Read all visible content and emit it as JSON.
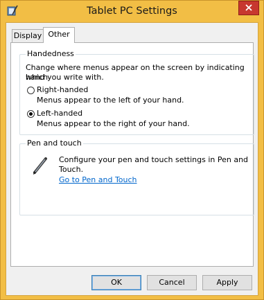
{
  "window": {
    "title": "Tablet PC Settings",
    "icon": "tablet-pc-settings-icon",
    "close_icon": "close-icon"
  },
  "tabs": [
    {
      "label": "Display",
      "selected": false
    },
    {
      "label": "Other",
      "selected": true
    }
  ],
  "handedness": {
    "legend": "Handedness",
    "description_line1": "Change where menus appear on the screen by indicating which",
    "description_line2": "hand you write with.",
    "options": [
      {
        "label": "Right-handed",
        "hint": "Menus appear to the left of your hand.",
        "checked": false
      },
      {
        "label": "Left-handed",
        "hint": "Menus appear to the right of your hand.",
        "checked": true
      }
    ]
  },
  "pen_and_touch": {
    "legend": "Pen and touch",
    "icon": "pen-icon",
    "description_line1": "Configure your pen and touch settings in Pen and",
    "description_line2": "Touch.",
    "link": "Go to Pen and Touch"
  },
  "buttons": {
    "ok": "OK",
    "cancel": "Cancel",
    "apply": "Apply"
  },
  "colors": {
    "frame": "#f2be45",
    "close_button": "#c7372f",
    "link": "#0066cc"
  }
}
